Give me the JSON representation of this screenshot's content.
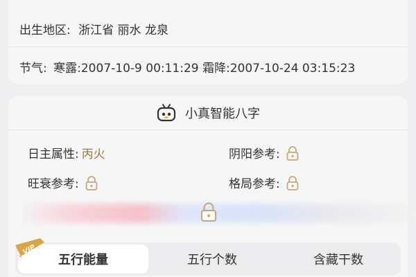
{
  "info": {
    "birth_region_label": "出生地区:",
    "birth_region_value": "浙江省 丽水 龙泉",
    "jieqi_label": "节气:",
    "jieqi_value": "寒露:2007-10-9 00:11:29 霜降:2007-10-24 03:15:23"
  },
  "bazi": {
    "title": "小真智能八字",
    "title_icon": "robot-icon",
    "day_master_label": "日主属性:",
    "day_master_value": "丙火",
    "yinyang_label": "阴阳参考:",
    "wangshuai_label": "旺衰参考:",
    "geju_label": "格局参考:",
    "lock_icon": "lock-icon"
  },
  "tabs": {
    "badge": "VIP",
    "items": [
      {
        "label": "五行能量",
        "active": true
      },
      {
        "label": "五行个数",
        "active": false
      },
      {
        "label": "含藏干数",
        "active": false
      }
    ]
  },
  "colors": {
    "accent": "#a07a3a",
    "vip": "#d9a441"
  }
}
